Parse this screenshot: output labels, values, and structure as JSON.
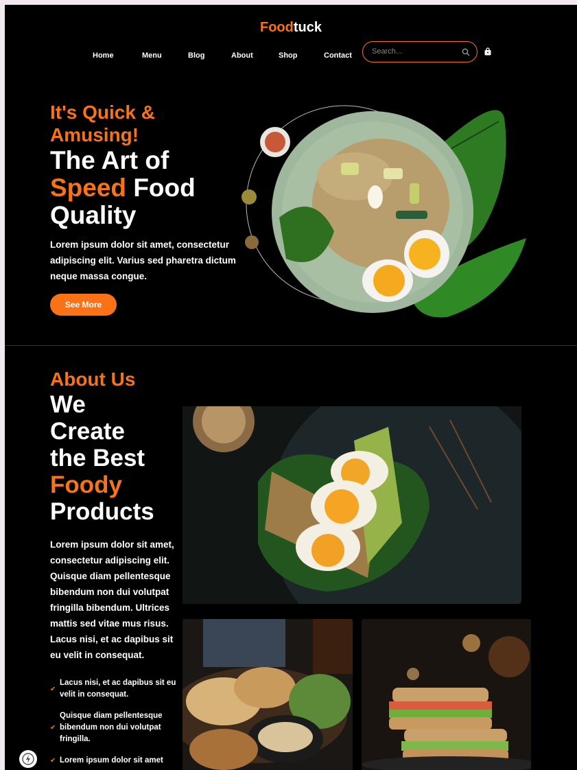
{
  "header": {
    "logo_part1": "Food",
    "logo_part2": "tuck",
    "nav": [
      "Home",
      "Menu",
      "Blog",
      "About",
      "Shop",
      "Contact"
    ],
    "search_placeholder": "Search..."
  },
  "hero": {
    "tagline": "It's Quick & Amusing!",
    "title_line1": "The Art of",
    "title_highlight": "Speed",
    "title_line2b": " Food",
    "title_line3": "Quality",
    "description": "Lorem ipsum dolor sit amet, consectetur adipiscing elit. Varius sed pharetra dictum neque massa congue.",
    "button_label": "See More"
  },
  "about": {
    "tagline": "About Us",
    "title_lines": [
      "We",
      "Create",
      "the Best"
    ],
    "title_highlight": "Foody",
    "title_last": "Products",
    "description": "Lorem ipsum dolor sit amet, consectetur adipiscing elit. Quisque diam pellentesque bibendum non dui volutpat fringilla bibendum. Ultrices mattis sed vitae mus risus. Lacus nisi, et ac dapibus sit eu velit in consequat.",
    "checks": [
      "Lacus nisi, et ac dapibus sit eu velit in consequat.",
      "Quisque diam pellentesque bibendum non dui volutpat fringilla.",
      "Lorem ipsum dolor sit amet"
    ]
  },
  "colors": {
    "accent": "#f97316",
    "background": "#000000",
    "text": "#ffffff"
  }
}
